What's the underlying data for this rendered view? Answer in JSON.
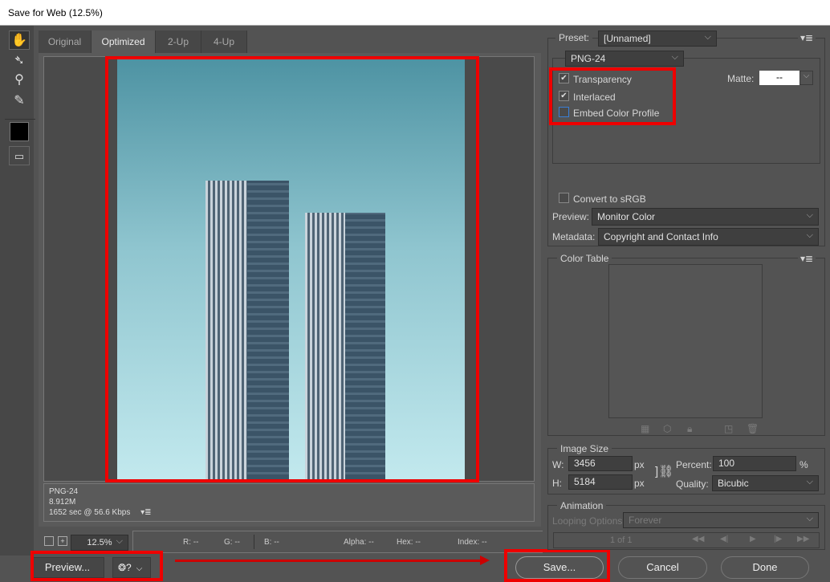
{
  "window": {
    "title": "Save for Web (12.5%)"
  },
  "tools": [
    "hand-icon",
    "slice-select-icon",
    "zoom-icon",
    "eyedropper-icon"
  ],
  "tabs": [
    {
      "label": "Original"
    },
    {
      "label": "Optimized"
    },
    {
      "label": "2-Up"
    },
    {
      "label": "4-Up"
    }
  ],
  "info": {
    "format": "PNG-24",
    "size": "8.912M",
    "download": "1652 sec @ 56.6 Kbps"
  },
  "zoom": {
    "value": "12.5%"
  },
  "pixel": {
    "r": "R: --",
    "g": "G: --",
    "b": "B: --",
    "alpha": "Alpha: --",
    "hex": "Hex: --",
    "index": "Index: --"
  },
  "buttons": {
    "preview": "Preview...",
    "save": "Save...",
    "cancel": "Cancel",
    "done": "Done"
  },
  "settings": {
    "preset_label": "Preset:",
    "preset": "[Unnamed]",
    "format": "PNG-24",
    "transparency": {
      "label": "Transparency",
      "checked": true
    },
    "interlaced": {
      "label": "Interlaced",
      "checked": true
    },
    "embed": {
      "label": "Embed Color Profile",
      "checked": false
    },
    "matte_label": "Matte:",
    "matte": "--",
    "srgb": {
      "label": "Convert to sRGB",
      "checked": false
    },
    "preview_label": "Preview:",
    "preview": "Monitor Color",
    "metadata_label": "Metadata:",
    "metadata": "Copyright and Contact Info"
  },
  "color_table": {
    "title": "Color Table"
  },
  "image_size": {
    "title": "Image Size",
    "w_label": "W:",
    "w": "3456",
    "h_label": "H:",
    "h": "5184",
    "unit": "px",
    "percent_label": "Percent:",
    "percent": "100",
    "percent_unit": "%",
    "quality_label": "Quality:",
    "quality": "Bicubic"
  },
  "animation": {
    "title": "Animation",
    "looping_label": "Looping Options:",
    "looping": "Forever",
    "frame": "1 of 1"
  },
  "colors": {
    "highlight": "#e00000"
  }
}
